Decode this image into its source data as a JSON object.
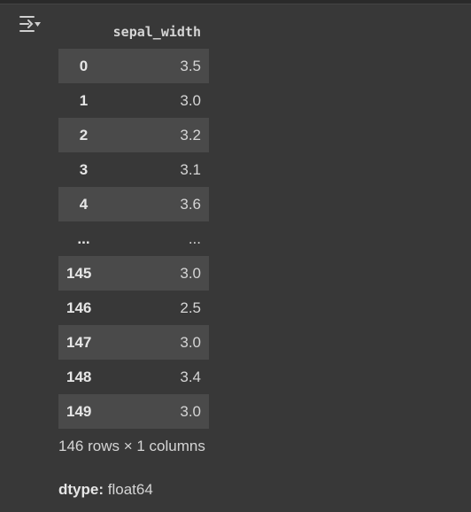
{
  "output_icon": "output-expand-icon",
  "table": {
    "column_header": "sepal_width",
    "rows": [
      {
        "index": "0",
        "value": "3.5"
      },
      {
        "index": "1",
        "value": "3.0"
      },
      {
        "index": "2",
        "value": "3.2"
      },
      {
        "index": "3",
        "value": "3.1"
      },
      {
        "index": "4",
        "value": "3.6"
      },
      {
        "index": "...",
        "value": "..."
      },
      {
        "index": "145",
        "value": "3.0"
      },
      {
        "index": "146",
        "value": "2.5"
      },
      {
        "index": "147",
        "value": "3.0"
      },
      {
        "index": "148",
        "value": "3.4"
      },
      {
        "index": "149",
        "value": "3.0"
      }
    ]
  },
  "summary": "146 rows × 1 columns",
  "dtype": {
    "label": "dtype:",
    "value": "float64"
  },
  "colors": {
    "background": "#383838",
    "striped_row": "#4a4a4a",
    "text": "#d5d5d5"
  }
}
